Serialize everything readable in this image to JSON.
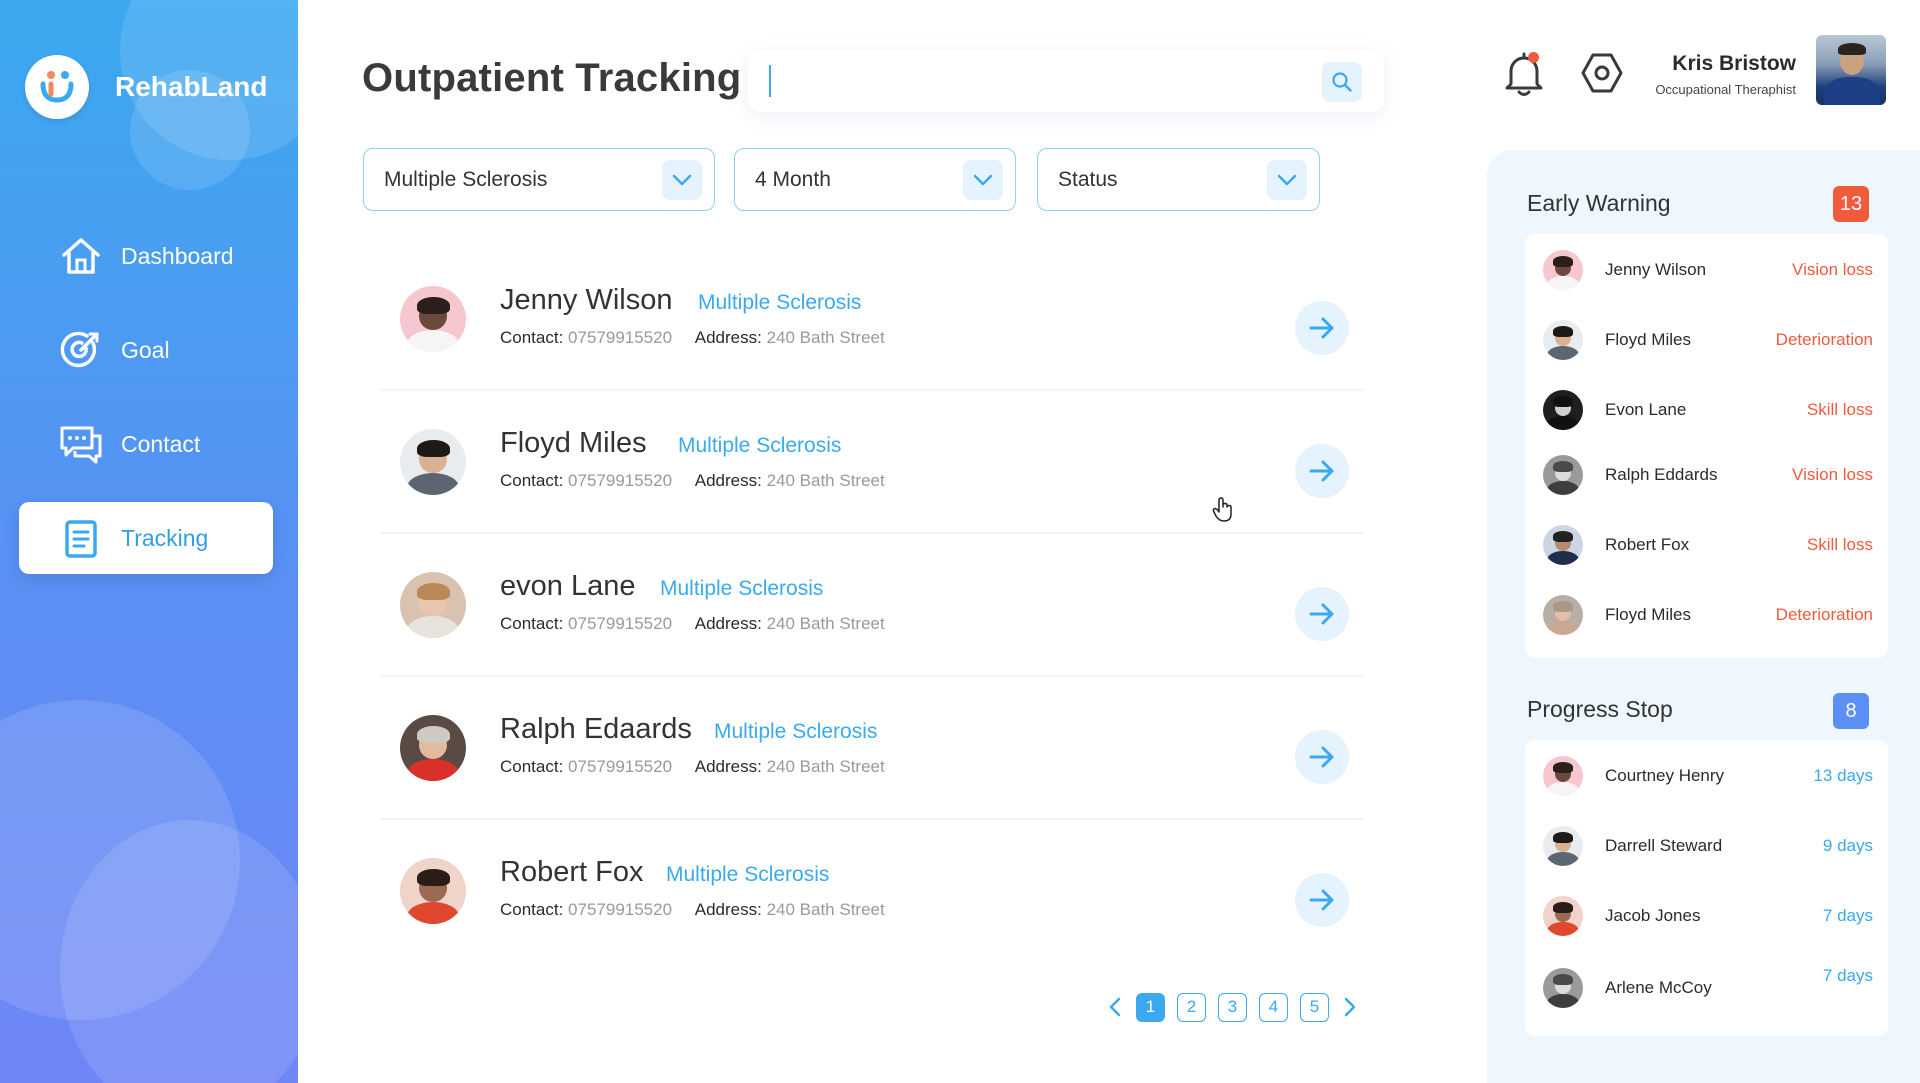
{
  "app": {
    "brand": "RehabLand"
  },
  "sidebar": {
    "items": [
      {
        "label": "Dashboard",
        "icon": "home-icon",
        "active": false
      },
      {
        "label": "Goal",
        "icon": "target-icon",
        "active": false
      },
      {
        "label": "Contact",
        "icon": "chat-icon",
        "active": false
      },
      {
        "label": "Tracking",
        "icon": "document-icon",
        "active": true
      }
    ]
  },
  "header": {
    "title": "Outpatient Tracking",
    "search": {
      "value": "",
      "placeholder": ""
    },
    "user": {
      "name": "Kris Bristow",
      "role": "Occupational Theraphist"
    }
  },
  "filters": {
    "condition": "Multiple Sclerosis",
    "period": "4 Month",
    "status": "Status"
  },
  "patients": {
    "contact_label": "Contact:",
    "address_label": "Address:",
    "list": [
      {
        "name": "Jenny Wilson",
        "condition": "Multiple Sclerosis",
        "contact": "07579915520",
        "address": "240 Bath Street"
      },
      {
        "name": "Floyd Miles",
        "condition": "Multiple Sclerosis",
        "contact": "07579915520",
        "address": "240 Bath Street"
      },
      {
        "name": "evon Lane",
        "condition": "Multiple Sclerosis",
        "contact": "07579915520",
        "address": "240 Bath Street"
      },
      {
        "name": "Ralph Edaards",
        "condition": "Multiple Sclerosis",
        "contact": "07579915520",
        "address": "240 Bath Street"
      },
      {
        "name": "Robert Fox",
        "condition": "Multiple Sclerosis",
        "contact": "07579915520",
        "address": "240 Bath Street"
      }
    ]
  },
  "pagination": {
    "pages": [
      "1",
      "2",
      "3",
      "4",
      "5"
    ],
    "current": "1"
  },
  "early_warning": {
    "title": "Early Warning",
    "count": "13",
    "items": [
      {
        "name": "Jenny Wilson",
        "status": "Vision loss"
      },
      {
        "name": "Floyd Miles",
        "status": "Deterioration"
      },
      {
        "name": "Evon Lane",
        "status": "Skill loss"
      },
      {
        "name": "Ralph Eddards",
        "status": "Vision loss"
      },
      {
        "name": "Robert Fox",
        "status": "Skill loss"
      },
      {
        "name": "Floyd Miles",
        "status": "Deterioration"
      }
    ]
  },
  "progress_stop": {
    "title": "Progress Stop",
    "count": "8",
    "items": [
      {
        "name": "Courtney Henry",
        "duration": "13 days"
      },
      {
        "name": "Darrell Steward",
        "duration": "9 days"
      },
      {
        "name": "Jacob Jones",
        "duration": "7 days"
      },
      {
        "name": "Arlene McCoy",
        "duration": "7 days"
      }
    ]
  },
  "colors": {
    "accent": "#3aa9ef",
    "warning": "#f25a3c",
    "badge_warning": "#f25a3c",
    "badge_progress": "#5b8ff4",
    "panel_bg": "#eef7fd"
  }
}
